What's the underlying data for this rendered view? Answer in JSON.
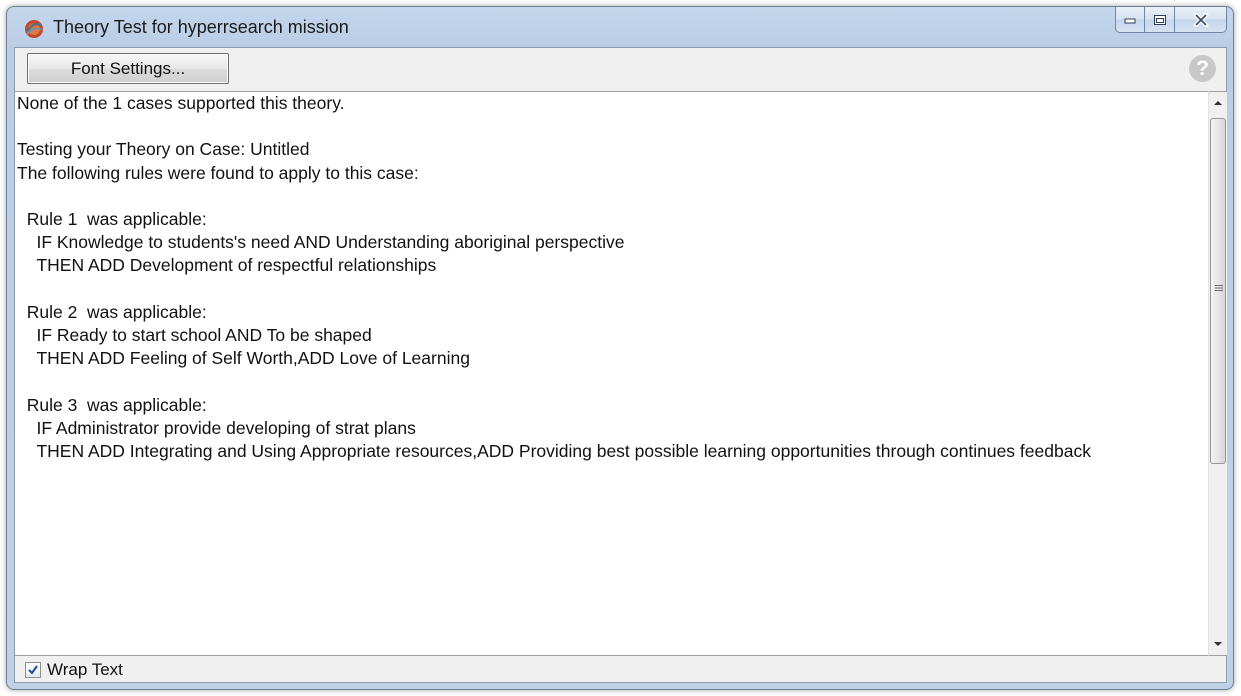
{
  "window": {
    "title": "Theory Test for hyperrsearch mission",
    "app_icon": "hyperresearch-app-icon",
    "caption_buttons": [
      "minimize-icon",
      "maximize-icon",
      "close-icon"
    ]
  },
  "toolbar": {
    "font_settings_label": "Font Settings...",
    "help_icon_glyph": "?"
  },
  "results": {
    "lines": [
      "None of the 1 cases supported this theory.",
      "",
      "Testing your Theory on Case: Untitled",
      "The following rules were found to apply to this case:",
      "",
      "  Rule 1  was applicable:",
      "    IF Knowledge to students's need AND Understanding aboriginal perspective",
      "    THEN ADD Development of respectful relationships",
      "",
      "  Rule 2  was applicable:",
      "    IF Ready to start school AND To be shaped",
      "    THEN ADD Feeling of Self Worth,ADD Love of Learning",
      "",
      "  Rule 3  was applicable:",
      "    IF Administrator provide developing of strat plans",
      "    THEN ADD Integrating and Using Appropriate resources,ADD Providing best possible learning opportunities through continues feedback"
    ]
  },
  "statusbar": {
    "wrap_text_label": "Wrap Text",
    "wrap_text_checked": true
  },
  "colors": {
    "title_bar": "#c3d6ec",
    "client_bg": "#f0f0f0",
    "text_bg": "#ffffff",
    "check_mark": "#1a4fa0"
  }
}
